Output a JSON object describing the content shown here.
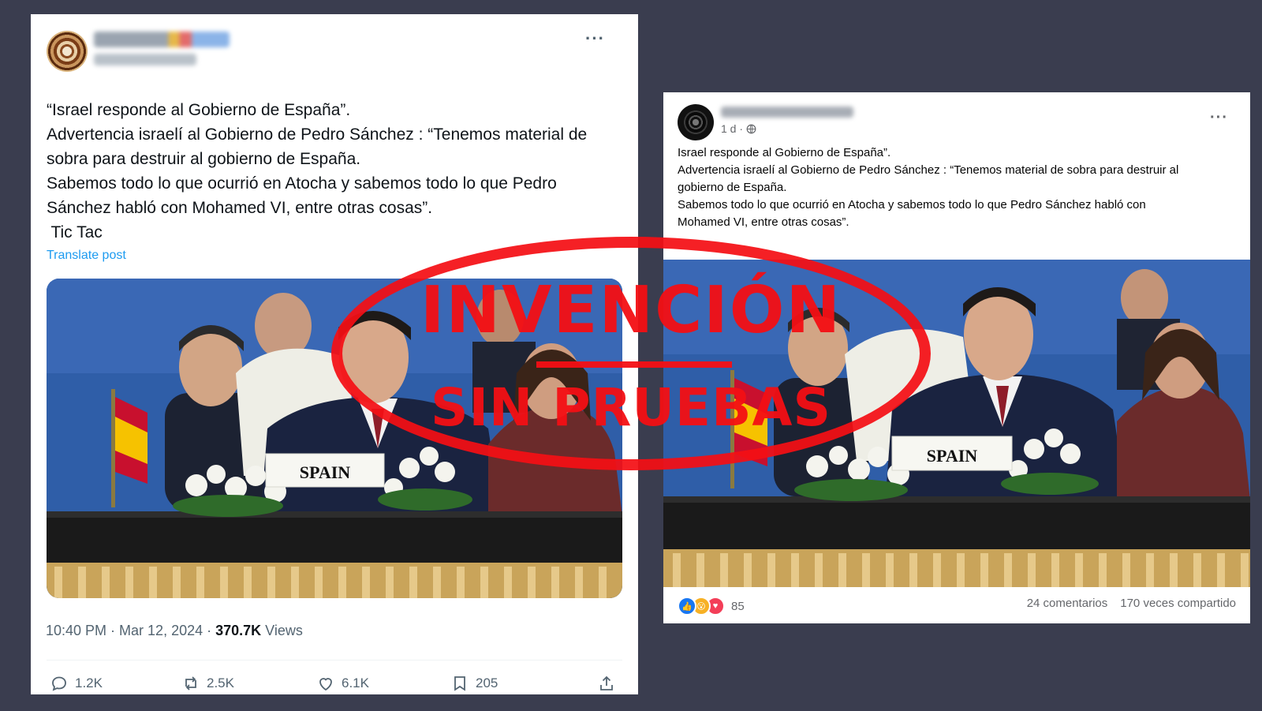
{
  "tweet": {
    "author_name": "",
    "author_handle": "",
    "more_label": "···",
    "text_lines": [
      "“Israel responde al Gobierno de España”.",
      "Advertencia israelí al Gobierno de Pedro Sánchez : “Tenemos material de",
      "sobra para destruir al gobierno de España.",
      "Sabemos todo lo que ocurrió en Atocha y sabemos todo lo que Pedro",
      "Sánchez habló con Mohamed VI, entre otras cosas”.",
      " Tic Tac"
    ],
    "translate_label": "Translate post",
    "image_placard": "SPAIN",
    "time": "10:40 PM · Mar 12, 2024 · ",
    "views_count": "370.7K",
    "views_label": " Views",
    "actions": {
      "replies": "1.2K",
      "reposts": "2.5K",
      "likes": "6.1K",
      "bookmarks": "205"
    },
    "icons": [
      "reply-icon",
      "repost-icon",
      "like-icon",
      "bookmark-icon",
      "share-icon"
    ]
  },
  "facebook": {
    "time": "1 d ·",
    "more_label": "···",
    "text_lines": [
      "Israel responde al Gobierno de España”.",
      "Advertencia israelí al Gobierno de Pedro Sánchez : “Tenemos material de sobra para destruir al",
      "gobierno de España.",
      "Sabemos todo lo que ocurrió en Atocha y sabemos todo lo que Pedro Sánchez habló con",
      "Mohamed VI, entre otras cosas”."
    ],
    "image_placard": "SPAIN",
    "reactions_count": "85",
    "comments": "24 comentarios",
    "shares": "170 veces compartido",
    "icons": [
      "like-reaction-icon",
      "wow-reaction-icon",
      "love-reaction-icon",
      "globe-icon"
    ]
  },
  "stamp": {
    "title": "INVENCIÓN",
    "subtitle": "SIN PRUEBAS",
    "color": "#f40f14"
  },
  "colors": {
    "background": "#3a3d4f",
    "twitter_link": "#1d9bf0",
    "twitter_muted": "#536471",
    "facebook_muted": "#65676b"
  }
}
